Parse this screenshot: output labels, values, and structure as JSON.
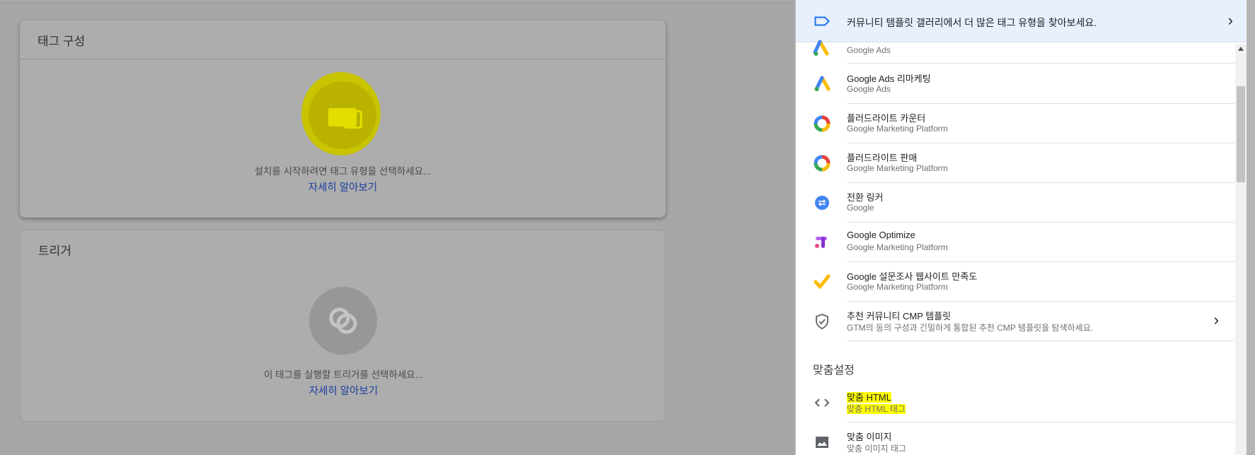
{
  "tag_card": {
    "title": "태그 구성",
    "hint": "설치를 시작하려면 태그 유형을 선택하세요...",
    "learn_more": "자세히 알아보기"
  },
  "trigger_card": {
    "title": "트리거",
    "hint": "이 태그를 실행할 트리거를 선택하세요...",
    "learn_more": "자세히 알아보기"
  },
  "panel": {
    "banner": "커뮤니티 템플릿 갤러리에서 더 많은 태그 유형을 찾아보세요.",
    "items": [
      {
        "title": "",
        "subtitle": "Google Ads",
        "icon": "google-ads-icon"
      },
      {
        "title": "Google Ads 리마케팅",
        "subtitle": "Google Ads",
        "icon": "google-ads-icon"
      },
      {
        "title": "플러드라이트 카운터",
        "subtitle": "Google Marketing Platform",
        "icon": "floodlight-icon"
      },
      {
        "title": "플러드라이트 판매",
        "subtitle": "Google Marketing Platform",
        "icon": "floodlight-icon"
      },
      {
        "title": "전환 링커",
        "subtitle": "Google",
        "icon": "conversion-linker-icon"
      },
      {
        "title": "Google Optimize",
        "subtitle": "Google Marketing Platform",
        "icon": "google-optimize-icon"
      },
      {
        "title": "Google 설문조사 웹사이트 만족도",
        "subtitle": "Google Marketing Platform",
        "icon": "google-surveys-icon"
      },
      {
        "title": "추천 커뮤니티 CMP 템플릿",
        "subtitle": "GTM의 동의 구성과 긴밀하게 통합된 추천 CMP 템플릿을 탐색하세요.",
        "icon": "shield-check-icon"
      }
    ],
    "custom_section": "맞춤설정",
    "custom_items": [
      {
        "title": "맞춤 HTML",
        "subtitle": "맞춤 HTML 태그",
        "icon": "code-brackets-icon"
      },
      {
        "title": "맞춤 이미지",
        "subtitle": "맞춤 이미지 태그",
        "icon": "image-icon"
      }
    ]
  },
  "colors": {
    "link": "#1a3fa0",
    "highlight": "#ffff00",
    "banner_bg": "#e8f0fe"
  }
}
